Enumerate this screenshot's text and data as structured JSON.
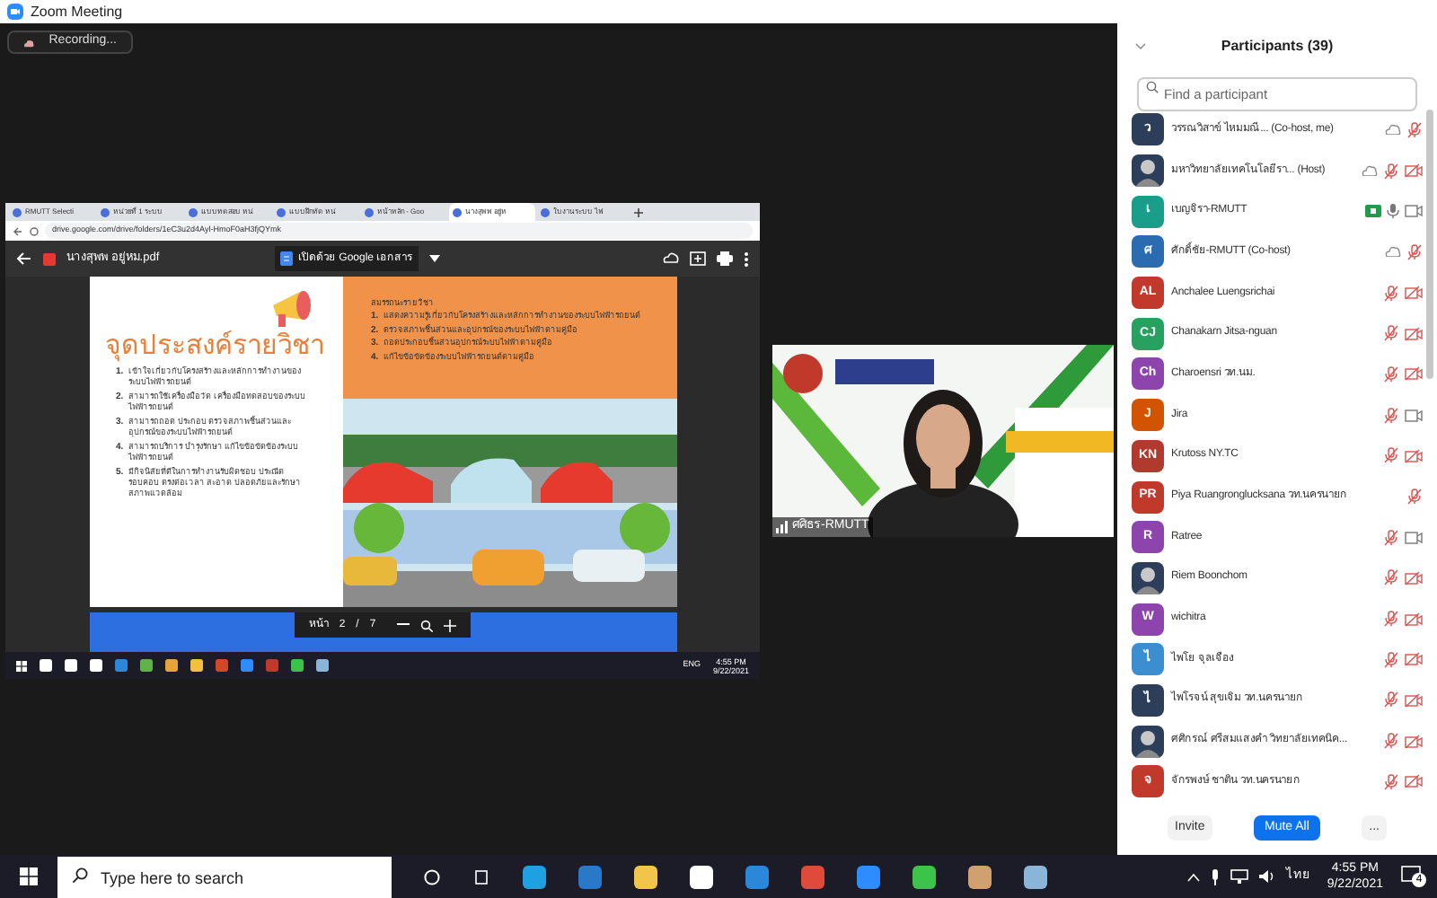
{
  "window": {
    "title": "Zoom Meeting"
  },
  "recording": {
    "label": "Recording..."
  },
  "shared_screen": {
    "browser_tabs": [
      {
        "label": "RMUTT Selecti",
        "selected": false
      },
      {
        "label": "หน่วยที่ 1 ระบบ",
        "selected": false
      },
      {
        "label": "แบบทดสอบ หน่",
        "selected": false
      },
      {
        "label": "แบบฝึกหัด หน่",
        "selected": false
      },
      {
        "label": "หน้าหลัก - Goo",
        "selected": false
      },
      {
        "label": "นางสุพพ อยู่ห",
        "selected": true
      },
      {
        "label": "ใบงานระบบ ไฟ",
        "selected": false
      }
    ],
    "url": "drive.google.com/drive/folders/1eC3u2d4Ayl-HmoF0aH3fjQYmk",
    "file_name": "นางสุพพ อยู่หม.pdf",
    "open_with": "เปิดด้วย Google เอกสาร",
    "slide": {
      "title": "จุดประสงค์รายวิชา",
      "objectives": [
        {
          "number": "1.",
          "text": "เข้าใจเกี่ยวกับโครงสร้างและหลักการทำงานของระบบไฟฟ้ารถยนต์"
        },
        {
          "number": "2.",
          "text": "สามารถใช้เครื่องมือวัด เครื่องมือทดสอบของระบบไฟฟ้ารถยนต์"
        },
        {
          "number": "3.",
          "text": "สามารถถอด ประกอบ ตรวจสภาพชิ้นส่วนและอุปกรณ์ของระบบไฟฟ้ารถยนต์"
        },
        {
          "number": "4.",
          "text": "สามารถบริการ บำรุงรักษา แก้ไขข้อขัดข้องระบบไฟฟ้ารถยนต์"
        },
        {
          "number": "5.",
          "text": "มีกิจนิสัยที่ดีในการทำงานรับผิดชอบ ประณีต รอบคอบ ตรงต่อเวลา สะอาด ปลอดภัยและรักษาสภาพแวดล้อม"
        }
      ],
      "competency_heading": "สมรรถนะรายวิชา",
      "competencies": [
        {
          "number": "1.",
          "text": "แสดงความรู้เกี่ยวกับโครงสร้างและหลักการทำงานของระบบไฟฟ้ารถยนต์"
        },
        {
          "number": "2.",
          "text": "ตรวจสภาพชิ้นส่วนและอุปกรณ์ของระบบไฟฟ้าตามคู่มือ"
        },
        {
          "number": "3.",
          "text": "ถอดประกอบชิ้นส่วนอุปกรณ์ระบบไฟฟ้าตามคู่มือ"
        },
        {
          "number": "4.",
          "text": "แก้ไขข้อขัดข้องระบบไฟฟ้ารถยนต์ตามคู่มือ"
        }
      ]
    },
    "page": {
      "label": "หน้า",
      "current": "2",
      "separator": "/",
      "total": "7"
    },
    "taskbar": {
      "language": "ENG",
      "time": "4:55 PM",
      "date": "9/22/2021"
    }
  },
  "video": {
    "name": "ศศิธร-RMUTT"
  },
  "participants": {
    "title": "Participants (39)",
    "search_placeholder": "Find a participant",
    "items": [
      {
        "kind": "initials",
        "initials": "ว",
        "color": "#2d3e5a",
        "name": "วรรณวิสาข์ ไหมมณี... (Co-host, me)",
        "icons": [
          {
            "kind": "cloud"
          },
          {
            "kind": "mic",
            "muted": true
          }
        ]
      },
      {
        "kind": "picture",
        "name": "มหาวิทยาลัยเทคโนโลยีรา... (Host)",
        "icons": [
          {
            "kind": "cloud"
          },
          {
            "kind": "mic",
            "muted": true
          },
          {
            "kind": "camera",
            "off": true
          }
        ]
      },
      {
        "kind": "initials",
        "initials": "เ",
        "color": "#1a9e8a",
        "name": "เบญจิรา-RMUTT",
        "icons": [
          {
            "kind": "badge"
          },
          {
            "kind": "mic",
            "muted": false
          },
          {
            "kind": "camera",
            "off": false
          }
        ]
      },
      {
        "kind": "initials",
        "initials": "ศ",
        "color": "#2b6cb0",
        "name": "ศักดิ์ชัย-RMUTT (Co-host)",
        "icons": [
          {
            "kind": "cloud"
          },
          {
            "kind": "mic",
            "muted": true
          }
        ]
      },
      {
        "kind": "initials",
        "initials": "AL",
        "color": "#c0392b",
        "name": "Anchalee Luengsrichai",
        "icons": [
          {
            "kind": "mic",
            "muted": true
          },
          {
            "kind": "camera",
            "off": true
          }
        ]
      },
      {
        "kind": "initials",
        "initials": "CJ",
        "color": "#27a060",
        "name": "Chanakarn Jitsa-nguan",
        "icons": [
          {
            "kind": "mic",
            "muted": true
          },
          {
            "kind": "camera",
            "off": true
          }
        ]
      },
      {
        "kind": "initials",
        "initials": "Ch",
        "color": "#8e44ad",
        "name": "Charoensri วท.นม.",
        "icons": [
          {
            "kind": "mic",
            "muted": true
          },
          {
            "kind": "camera",
            "off": true
          }
        ]
      },
      {
        "kind": "initials",
        "initials": "J",
        "color": "#d35400",
        "name": "Jira",
        "icons": [
          {
            "kind": "mic",
            "muted": true
          },
          {
            "kind": "camera",
            "off": false
          }
        ]
      },
      {
        "kind": "initials",
        "initials": "KN",
        "color": "#b03a2e",
        "name": "Krutoss NY.TC",
        "icons": [
          {
            "kind": "mic",
            "muted": true
          },
          {
            "kind": "camera",
            "off": true
          }
        ]
      },
      {
        "kind": "initials",
        "initials": "PR",
        "color": "#c0392b",
        "name": "Piya Ruangronglucksana วท.นครนายก",
        "icons": [
          {
            "kind": "mic",
            "muted": true
          }
        ]
      },
      {
        "kind": "initials",
        "initials": "R",
        "color": "#8e44ad",
        "name": "Ratree",
        "icons": [
          {
            "kind": "mic",
            "muted": true
          },
          {
            "kind": "camera",
            "off": false
          }
        ]
      },
      {
        "kind": "picture",
        "name": "Riem Boonchom",
        "icons": [
          {
            "kind": "mic",
            "muted": true
          },
          {
            "kind": "camera",
            "off": true
          }
        ]
      },
      {
        "kind": "initials",
        "initials": "W",
        "color": "#8e44ad",
        "name": "wichitra",
        "icons": [
          {
            "kind": "mic",
            "muted": true
          },
          {
            "kind": "camera",
            "off": true
          }
        ]
      },
      {
        "kind": "initials",
        "initials": "ไ",
        "color": "#3b8fd0",
        "name": "ไพโย จุลเจือง",
        "icons": [
          {
            "kind": "mic",
            "muted": true
          },
          {
            "kind": "camera",
            "off": true
          }
        ]
      },
      {
        "kind": "initials",
        "initials": "ไ",
        "color": "#2d3e5a",
        "name": "ไพโรจน์ สุขเจิม วท.นครนายก",
        "icons": [
          {
            "kind": "mic",
            "muted": true
          },
          {
            "kind": "camera",
            "off": true
          }
        ]
      },
      {
        "kind": "picture",
        "name": "ศศิกรณ์ ศรีสมแสงคำ วิทยาลัยเทคนิค...",
        "icons": [
          {
            "kind": "mic",
            "muted": true
          },
          {
            "kind": "camera",
            "off": true
          }
        ]
      },
      {
        "kind": "initials",
        "initials": "จ",
        "color": "#c0392b",
        "name": "จักรพงษ์ ชาติน วท.นครนายก",
        "icons": [
          {
            "kind": "mic",
            "muted": true
          },
          {
            "kind": "camera",
            "off": true
          }
        ]
      }
    ],
    "buttons": [
      {
        "label": "Invite",
        "primary": false
      },
      {
        "label": "Mute All",
        "primary": true
      },
      {
        "label": "...",
        "primary": false
      }
    ]
  },
  "taskbar": {
    "search_placeholder": "Type here to search",
    "language": "ไทย",
    "time": "4:55 PM",
    "date": "9/22/2021",
    "notifications": "4"
  }
}
